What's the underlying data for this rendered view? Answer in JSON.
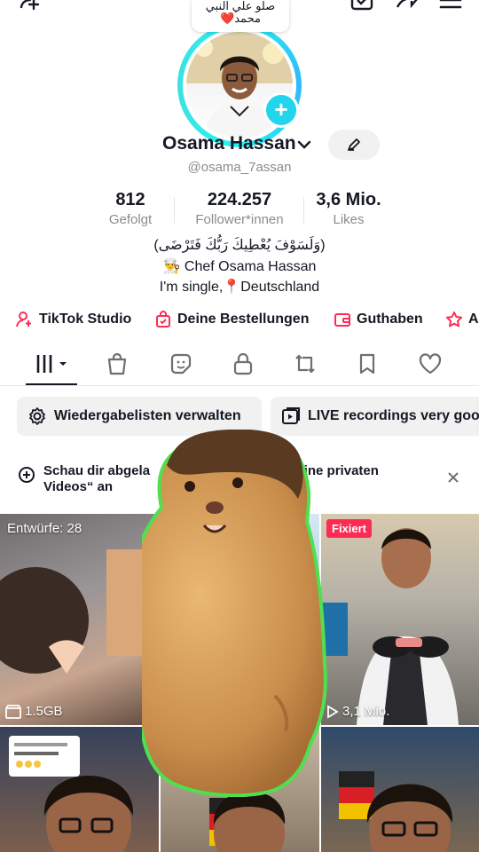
{
  "bubble": {
    "line1": "صلو علي النبي",
    "line2": "محمد"
  },
  "profile": {
    "name": "Osama Hassan",
    "handle": "@osama_7assan",
    "stats": [
      {
        "value": "812",
        "label": "Gefolgt"
      },
      {
        "value": "224.257",
        "label": "Follower*innen"
      },
      {
        "value": "3,6 Mio.",
        "label": "Likes"
      }
    ],
    "bio": [
      "(وَلَسَوْفَ يُعْطِيكَ رَبُّكَ فَتَرْضَى)",
      "Chef Osama Hassan",
      "I'm single,",
      "Deutschland"
    ]
  },
  "quick_links": [
    "TikTok Studio",
    "Deine Bestellungen",
    "Guthaben",
    "Al"
  ],
  "tabs": [
    "videos-grid",
    "shop",
    "favorites-sticker",
    "private-lock",
    "repost",
    "bookmark",
    "liked"
  ],
  "pills": {
    "playlists": "Wiedergabelisten verwalten",
    "live": "LIVE recordings very goo"
  },
  "notice": {
    "line1": "Schau dir abgela",
    "line1b": "„Deine privaten",
    "line2": "Videos“ an"
  },
  "grid": {
    "drafts": "Entwürfe: 28",
    "size": "1.5GB",
    "pinned": "Fixiert",
    "views": "3,1 Mio."
  },
  "accent": "#fe2c55",
  "ring_color": "#25f4ee"
}
